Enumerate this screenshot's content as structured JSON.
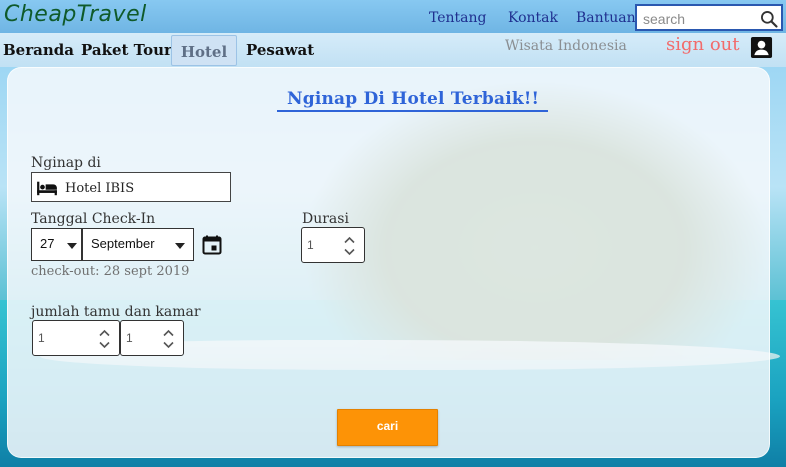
{
  "header": {
    "logo": "CheapTravel",
    "links": [
      "Tentang",
      "Kontak",
      "Bantuan"
    ],
    "search": {
      "placeholder": "search",
      "value": ""
    },
    "search_icon": "search-icon"
  },
  "nav": {
    "items": [
      "Beranda",
      "Paket Tour",
      "Hotel",
      "Pesawat"
    ],
    "active": "Hotel",
    "wisata": "Wisata Indonesia",
    "signout": "sign out",
    "user_icon": "account-box-icon"
  },
  "form": {
    "title": "Nginap Di Hotel Terbaik!!",
    "stay_label": "Nginap di",
    "hotel_value": "Hotel IBIS",
    "hotel_icon": "bed-icon",
    "checkin_label": "Tanggal Check-In",
    "day_value": "27",
    "month_value": "September",
    "calendar_icon": "calendar-icon",
    "checkout_text": "check-out: 28 sept 2019",
    "duration_label": "Durasi",
    "duration_value": "1",
    "guests_label": "jumlah tamu dan kamar",
    "guests_value": "1",
    "rooms_value": "1",
    "search_button": "cari"
  },
  "colors": {
    "accent": "#2f64d8",
    "button": "#fd9306",
    "signout": "#f26b6b",
    "logo": "#0f5a2a"
  }
}
